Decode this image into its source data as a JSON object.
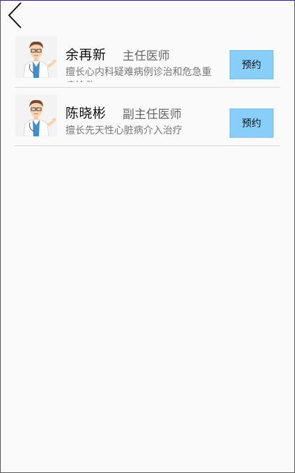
{
  "nav": {
    "back_icon": "chevron-left-icon"
  },
  "doctors": [
    {
      "name": "余再新",
      "title": "主任医师",
      "desc": "擅长心内科疑难病例诊治和危急重症抢救",
      "book_label": "预约",
      "avatar_icon": "doctor-avatar-icon"
    },
    {
      "name": "陈晓彬",
      "title": "副主任医师",
      "desc": "擅长先天性心脏病介入治疗",
      "book_label": "预约",
      "avatar_icon": "doctor-avatar-icon"
    }
  ],
  "colors": {
    "book_button": "#87cefa",
    "background": "#fafafa",
    "divider": "#d7d7d7"
  }
}
